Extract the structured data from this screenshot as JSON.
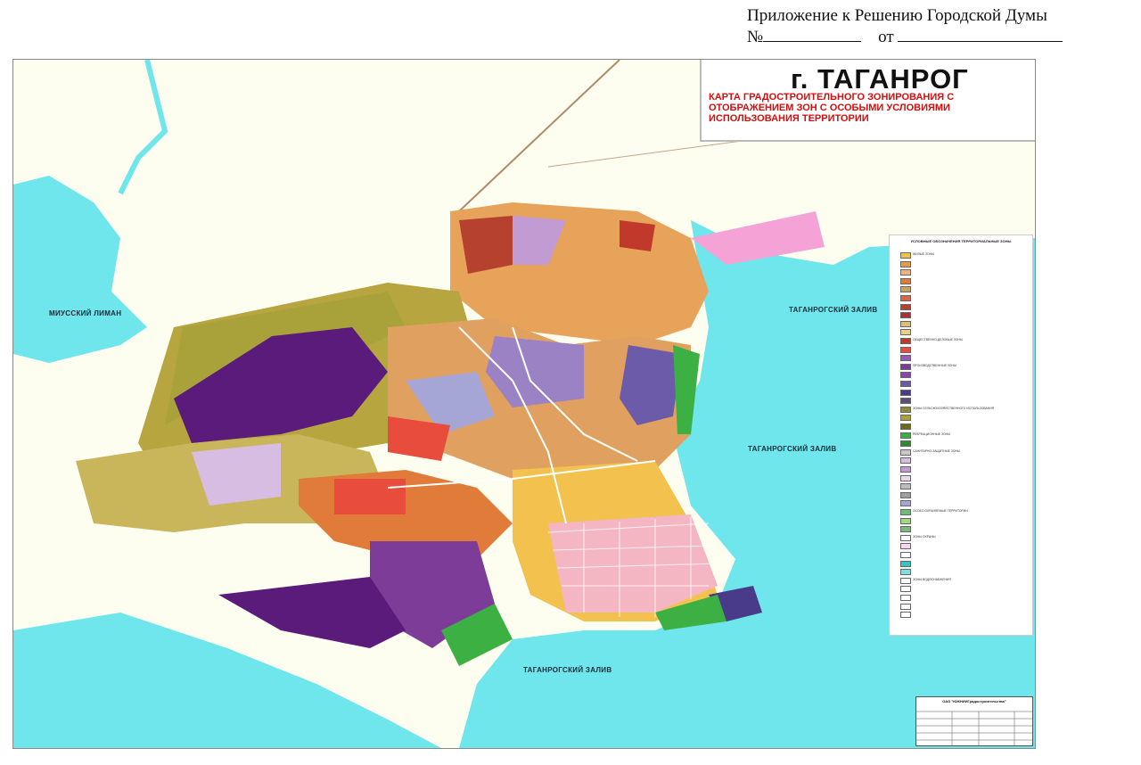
{
  "document_header": {
    "line1": "Приложение к Решению Городской Думы",
    "number_prefix": "№",
    "date_prefix": "от"
  },
  "map_title": {
    "city": "г. ТАГАНРОГ",
    "subtitle": "КАРТА ГРАДОСТРОИТЕЛЬНОГО ЗОНИРОВАНИЯ С ОТОБРАЖЕНИЕМ ЗОН С ОСОБЫМИ УСЛОВИЯМИ ИСПОЛЬЗОВАНИЯ ТЕРРИТОРИИ",
    "title_color": "#111111",
    "subtitle_color": "#d01010"
  },
  "water_labels": {
    "miussky": "МИУССКИЙ ЛИМАН",
    "bay_upper": "ТАГАНРОГСКИЙ ЗАЛИВ",
    "bay_middle": "ТАГАНРОГСКИЙ ЗАЛИВ",
    "bay_lower": "ТАГАНРОГСКИЙ ЗАЛИВ"
  },
  "legend": {
    "heading": "УСЛОВНЫЕ ОБОЗНАЧЕНИЯ ТЕРРИТОРИАЛЬНЫЕ ЗОНЫ",
    "groups": [
      {
        "color": "#f2c14e",
        "label": "ЖИЛЫЕ ЗОНЫ"
      },
      {
        "color": "#e89a4a",
        "label": ""
      },
      {
        "color": "#f4b183",
        "label": ""
      },
      {
        "color": "#e07b39",
        "label": ""
      },
      {
        "color": "#c9a45c",
        "label": ""
      },
      {
        "color": "#d9644a",
        "label": ""
      },
      {
        "color": "#b5412e",
        "label": ""
      },
      {
        "color": "#a83232",
        "label": ""
      },
      {
        "color": "#d6c07a",
        "label": ""
      },
      {
        "color": "#e8d08a",
        "label": ""
      },
      {
        "color": "#c0392b",
        "label": "ОБЩЕСТВЕННО-ДЕЛОВЫЕ ЗОНЫ"
      },
      {
        "color": "#e74c3c",
        "label": ""
      },
      {
        "color": "#9b59b6",
        "label": ""
      },
      {
        "color": "#7d3c98",
        "label": "ПРОИЗВОДСТВЕННЫЕ ЗОНЫ"
      },
      {
        "color": "#8e44ad",
        "label": ""
      },
      {
        "color": "#6c5ba8",
        "label": ""
      },
      {
        "color": "#4a3a8a",
        "label": ""
      },
      {
        "color": "#5b4e7a",
        "label": ""
      },
      {
        "color": "#8a8a3a",
        "label": "ЗОНЫ СЕЛЬСКОХОЗЯЙСТВЕННОГО ИСПОЛЬЗОВАНИЯ"
      },
      {
        "color": "#a9a23a",
        "label": ""
      },
      {
        "color": "#6b6b20",
        "label": ""
      },
      {
        "color": "#3cb043",
        "label": "РЕКРЕАЦИОННЫЕ ЗОНЫ"
      },
      {
        "color": "#2e8b2e",
        "label": ""
      },
      {
        "color": "#c8c8c8",
        "label": "САНИТАРНО-ЗАЩИТНЫЕ ЗОНЫ"
      },
      {
        "color": "#d7bde2",
        "label": ""
      },
      {
        "color": "#c39bd3",
        "label": ""
      },
      {
        "color": "#e8daef",
        "label": ""
      },
      {
        "color": "#bdbdbd",
        "label": ""
      },
      {
        "color": "#9e9e9e",
        "label": ""
      },
      {
        "color": "#a5a5d6",
        "label": ""
      },
      {
        "color": "#6fbf73",
        "label": "ОСОБО ОХРАНЯЕМЫЕ ТЕРРИТОРИИ"
      },
      {
        "color": "#a3d977",
        "label": ""
      },
      {
        "color": "#7fb77e",
        "label": ""
      },
      {
        "color": "#ffffff",
        "label": "ЗОНЫ ОХРАНЫ"
      },
      {
        "color": "#f5d5f0",
        "label": ""
      },
      {
        "color": "#ffffff",
        "label": ""
      },
      {
        "color": "#35c4c4",
        "label": ""
      },
      {
        "color": "#7de0e0",
        "label": ""
      },
      {
        "color": "#ffffff",
        "label": "ЗОНЫ ВОДОСНАБЖЕНИЯ"
      },
      {
        "color": "#ffffff",
        "label": ""
      },
      {
        "color": "#ffffff",
        "label": ""
      },
      {
        "color": "#ffffff",
        "label": ""
      },
      {
        "color": "#ffffff",
        "label": ""
      }
    ]
  },
  "stamp": {
    "org": "ОАО \"ЮЖНИИГрадостроительства\""
  },
  "colors": {
    "sea": "#6ee6ec",
    "land": "#fdfdf0",
    "residential": "#e8a35a",
    "industrial": "#5a1b7a",
    "agricultural": "#b7a640",
    "green": "#3cb043"
  }
}
